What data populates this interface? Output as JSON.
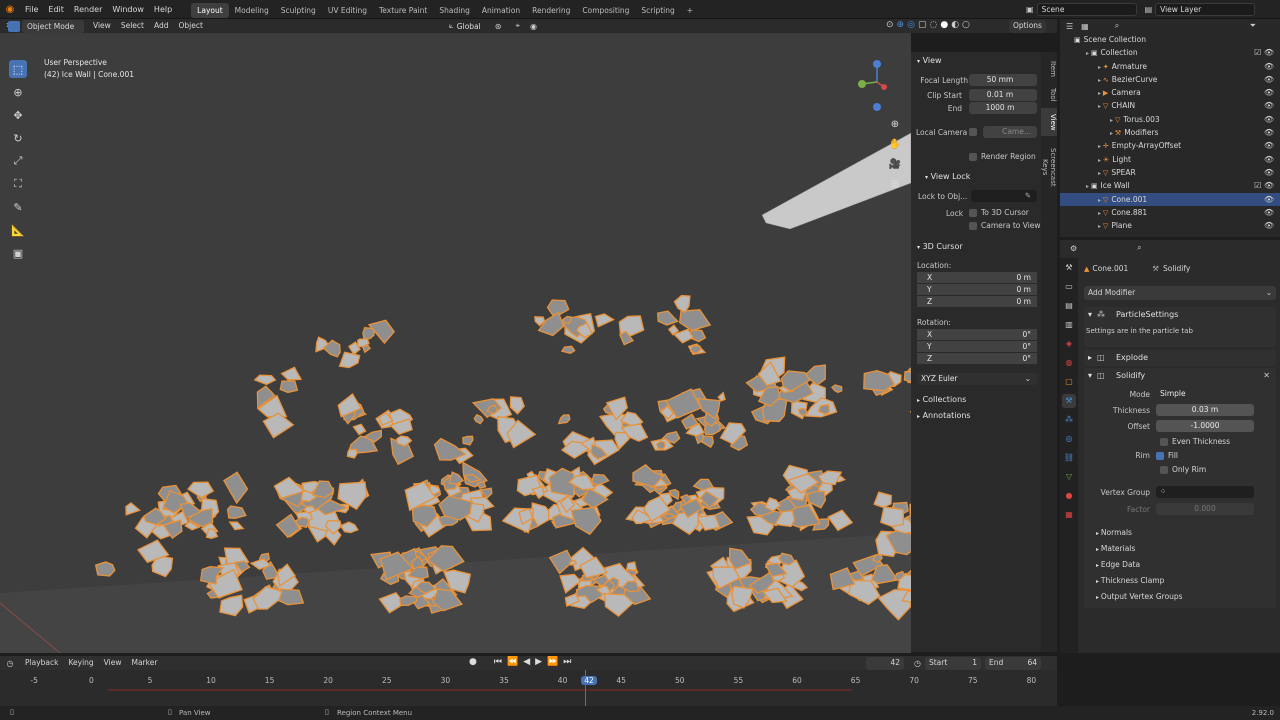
{
  "app": {
    "menus": [
      "File",
      "Edit",
      "Render",
      "Window",
      "Help"
    ],
    "workspaces": [
      "Layout",
      "Modeling",
      "Sculpting",
      "UV Editing",
      "Texture Paint",
      "Shading",
      "Animation",
      "Rendering",
      "Compositing",
      "Scripting"
    ],
    "active_workspace": "Layout",
    "add_tab": "+",
    "scene": "Scene",
    "view_layer": "View Layer"
  },
  "viewport_header": {
    "transform_orientation": "Global",
    "options": "Options",
    "mode": "Object Mode",
    "menus": [
      "View",
      "Select",
      "Add",
      "Object"
    ]
  },
  "viewport": {
    "perspective": "User Perspective",
    "context": "(42) Ice Wall | Cone.001",
    "accent": "#e8923a"
  },
  "npanel": {
    "view_header": "View",
    "focal_length_label": "Focal Length",
    "focal_length": "50 mm",
    "clip_start_label": "Clip Start",
    "clip_start": "0.01 m",
    "end_label": "End",
    "end": "1000 m",
    "local_camera_label": "Local Camera",
    "local_camera_value": "Came...",
    "render_region": "Render Region",
    "view_lock_header": "View Lock",
    "lock_to_obj_label": "Lock to Obj...",
    "lock_label": "Lock",
    "to_3d_cursor": "To 3D Cursor",
    "camera_to_view": "Camera to View",
    "cursor_header": "3D Cursor",
    "location_label": "Location:",
    "loc": [
      {
        "axis": "X",
        "val": "0 m"
      },
      {
        "axis": "Y",
        "val": "0 m"
      },
      {
        "axis": "Z",
        "val": "0 m"
      }
    ],
    "rotation_label": "Rotation:",
    "rot": [
      {
        "axis": "X",
        "val": "0°"
      },
      {
        "axis": "Y",
        "val": "0°"
      },
      {
        "axis": "Z",
        "val": "0°"
      }
    ],
    "rotation_mode": "XYZ Euler",
    "collections": "Collections",
    "annotations": "Annotations",
    "tabs": [
      "Item",
      "Tool",
      "View",
      "Screencast Keys"
    ]
  },
  "outliner": {
    "root": "Scene Collection",
    "rows": [
      {
        "label": "Collection",
        "indent": 1
      },
      {
        "label": "Armature",
        "indent": 2
      },
      {
        "label": "BezierCurve",
        "indent": 2
      },
      {
        "label": "Camera",
        "indent": 2
      },
      {
        "label": "CHAIN",
        "indent": 2
      },
      {
        "label": "Torus.003",
        "indent": 3
      },
      {
        "label": "Modifiers",
        "indent": 3
      },
      {
        "label": "Empty-ArrayOffset",
        "indent": 2
      },
      {
        "label": "Light",
        "indent": 2
      },
      {
        "label": "SPEAR",
        "indent": 2
      },
      {
        "label": "Ice Wall",
        "indent": 1
      },
      {
        "label": "Cone.001",
        "indent": 2,
        "selected": true
      },
      {
        "label": "Cone.881",
        "indent": 2
      },
      {
        "label": "Plane",
        "indent": 2
      }
    ]
  },
  "properties": {
    "object_name": "Cone.001",
    "modifier_context": "Solidify",
    "add_modifier": "Add Modifier",
    "particle_settings": "ParticleSettings",
    "particle_note": "Settings are in the particle tab",
    "explode": "Explode",
    "solidify": "Solidify",
    "mode_label": "Mode",
    "mode_value": "Simple",
    "thickness_label": "Thickness",
    "thickness_value": "0.03 m",
    "offset_label": "Offset",
    "offset_value": "-1.0000",
    "even_thickness": "Even Thickness",
    "rim_label": "Rim",
    "fill": "Fill",
    "only_rim": "Only Rim",
    "vertex_group_label": "Vertex Group",
    "factor_label": "Factor",
    "factor_value": "0.000",
    "subpanels": [
      "Normals",
      "Materials",
      "Edge Data",
      "Thickness Clamp",
      "Output Vertex Groups"
    ]
  },
  "timeline": {
    "menus": [
      "Playback",
      "Keying",
      "View",
      "Marker"
    ],
    "current_frame": "42",
    "start_label": "Start",
    "start": "1",
    "end_label": "End",
    "end": "64",
    "ticks": [
      "-5",
      "0",
      "5",
      "10",
      "15",
      "20",
      "25",
      "30",
      "35",
      "40",
      "42",
      "45",
      "50",
      "55",
      "60",
      "65",
      "70",
      "75",
      "80"
    ]
  },
  "status": {
    "pan_view": "Pan View",
    "region_context_menu": "Region Context Menu",
    "version": "2.92.0"
  }
}
